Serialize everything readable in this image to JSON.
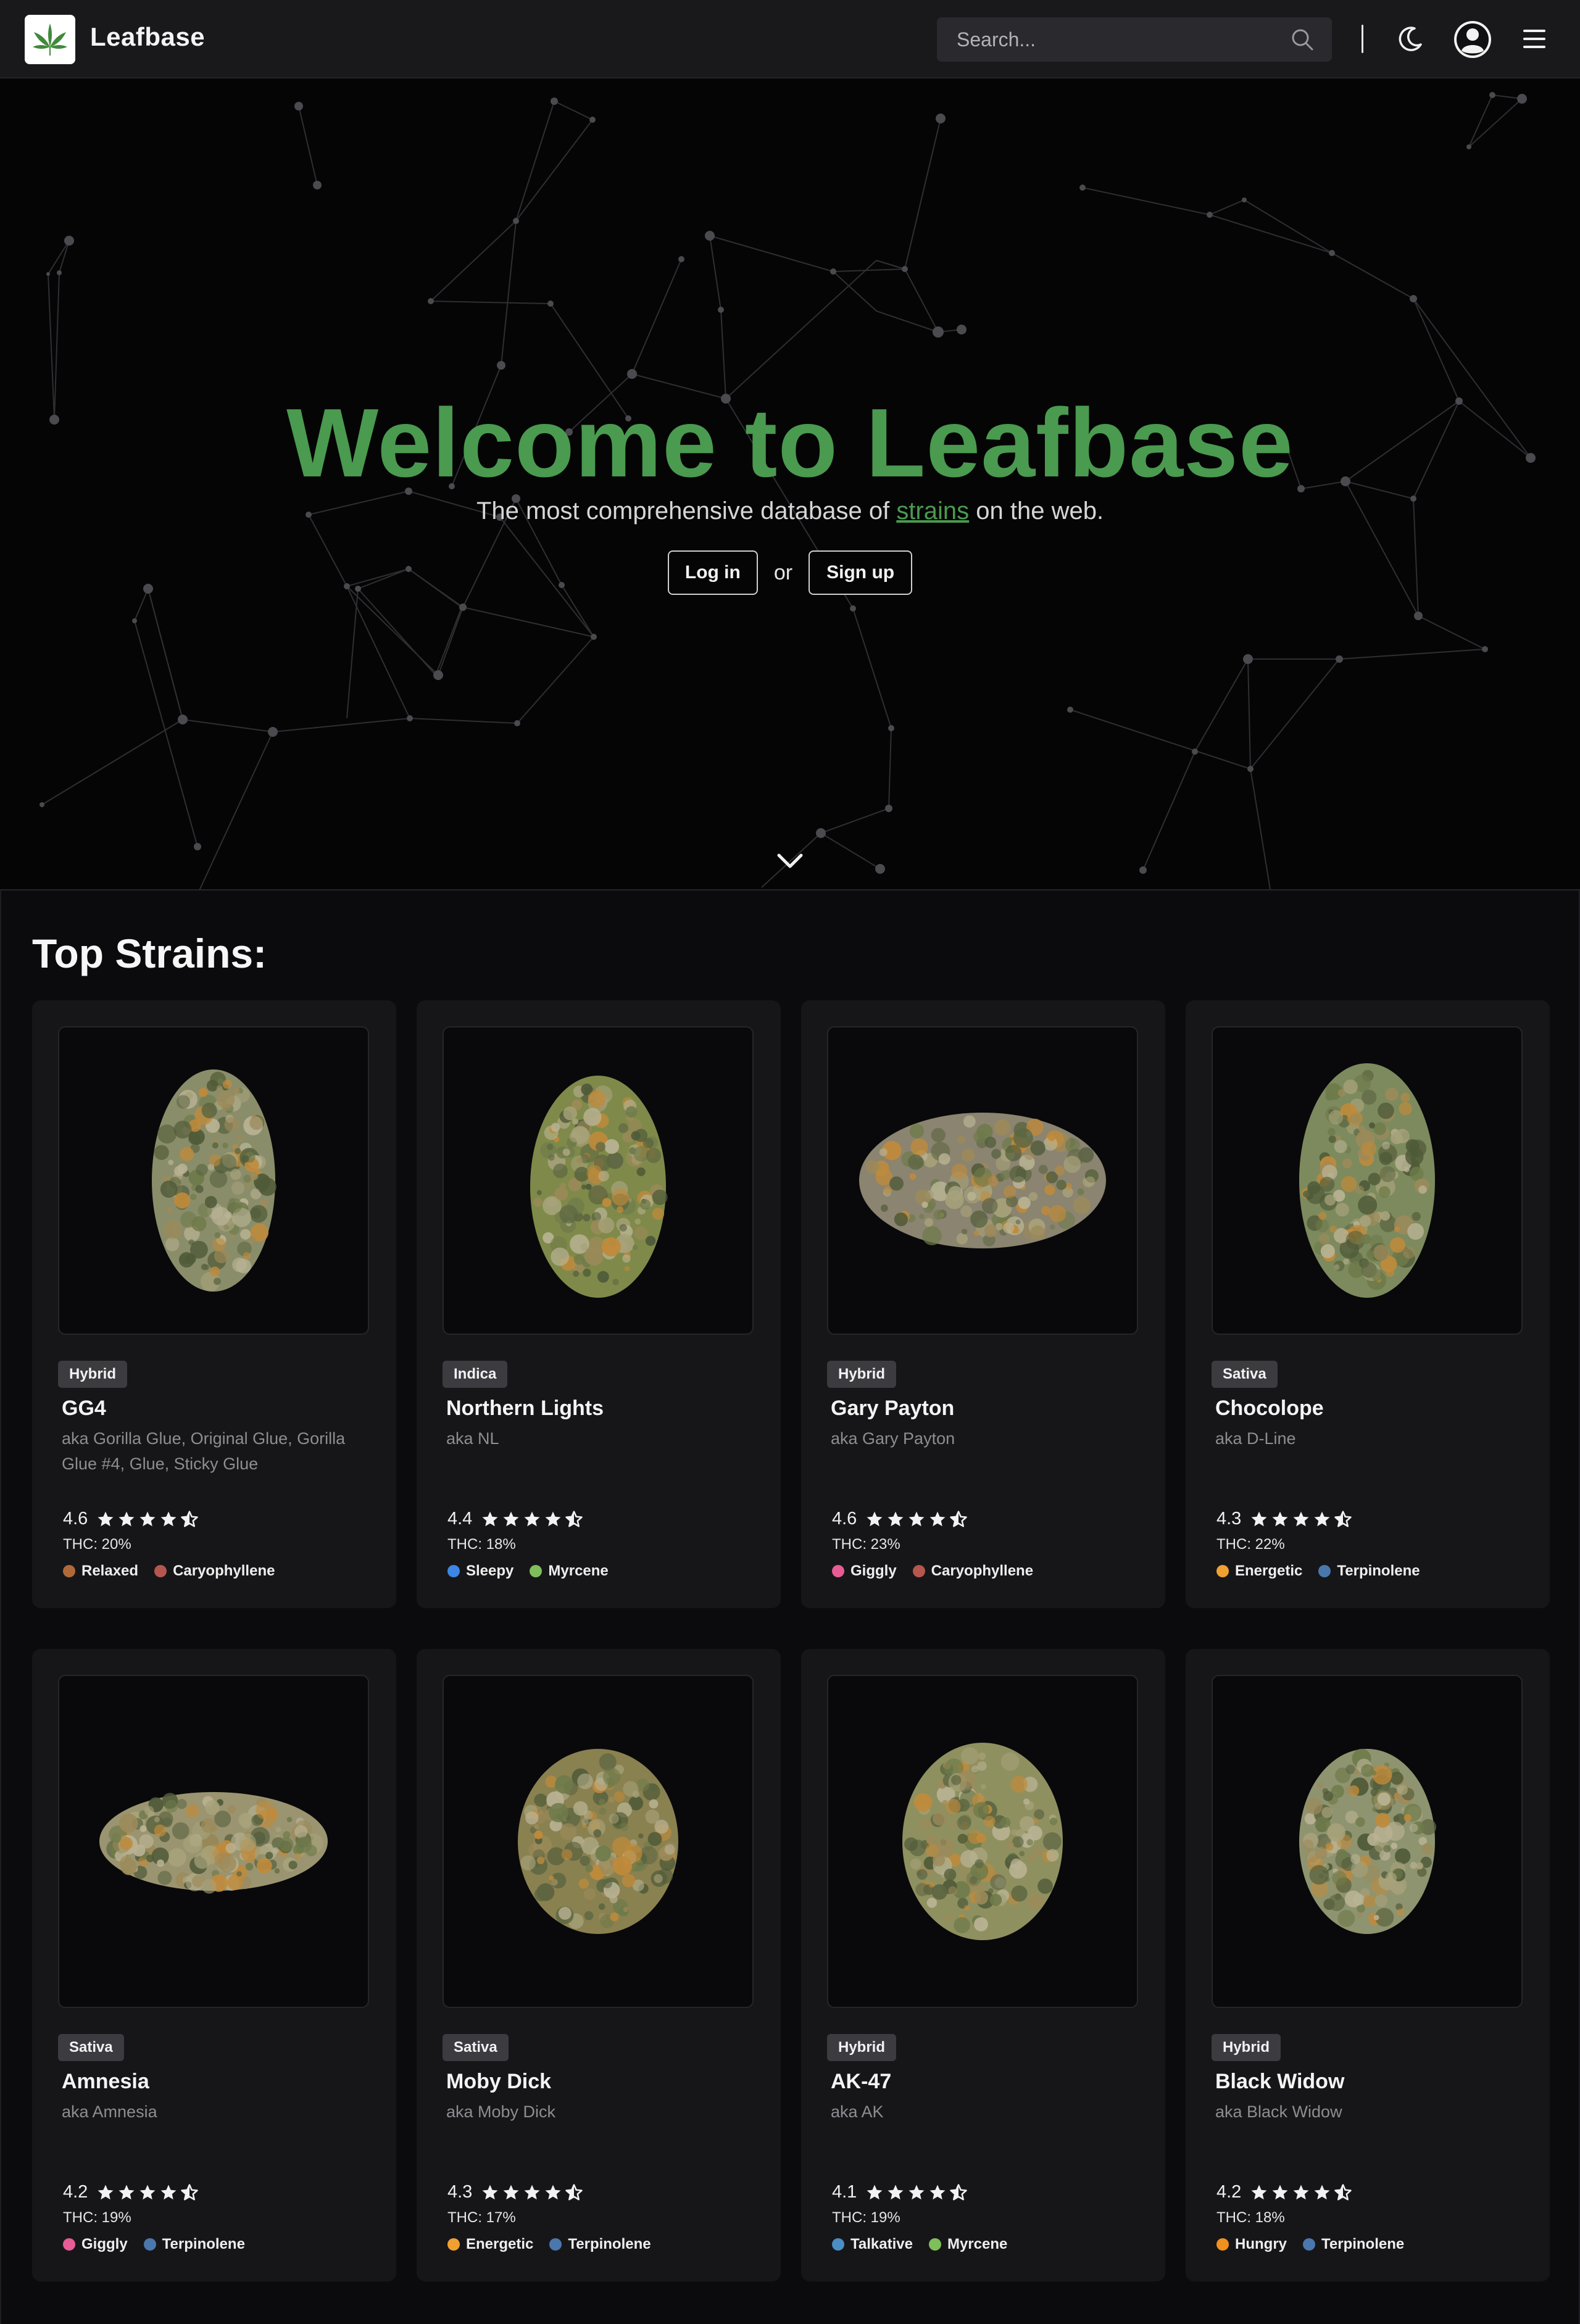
{
  "header": {
    "brand": "Leafbase",
    "search_placeholder": "Search..."
  },
  "hero": {
    "title": "Welcome to Leafbase",
    "subtitle_before": "The most comprehensive database of ",
    "subtitle_link": "strains",
    "subtitle_after": " on the web.",
    "login_label": "Log in",
    "or_label": "or",
    "signup_label": "Sign up"
  },
  "main": {
    "section_title": "Top Strains:"
  },
  "strains": [
    {
      "type": "Hybrid",
      "name": "GG4",
      "aka": "aka Gorilla Glue, Original Glue, Gorilla Glue #4, Glue, Sticky Glue",
      "rating": "4.6",
      "thc": "THC: 20%",
      "tags": [
        {
          "label": "Relaxed",
          "color": "#b06a3a"
        },
        {
          "label": "Caryophyllene",
          "color": "#b5574e"
        }
      ]
    },
    {
      "type": "Indica",
      "name": "Northern Lights",
      "aka": "aka NL",
      "rating": "4.4",
      "thc": "THC: 18%",
      "tags": [
        {
          "label": "Sleepy",
          "color": "#3e86e4"
        },
        {
          "label": "Myrcene",
          "color": "#7fbf5b"
        }
      ]
    },
    {
      "type": "Hybrid",
      "name": "Gary Payton",
      "aka": "aka Gary Payton",
      "rating": "4.6",
      "thc": "THC: 23%",
      "tags": [
        {
          "label": "Giggly",
          "color": "#e85c96"
        },
        {
          "label": "Caryophyllene",
          "color": "#b5574e"
        }
      ]
    },
    {
      "type": "Sativa",
      "name": "Chocolope",
      "aka": "aka D-Line",
      "rating": "4.3",
      "thc": "THC: 22%",
      "tags": [
        {
          "label": "Energetic",
          "color": "#f0a030"
        },
        {
          "label": "Terpinolene",
          "color": "#4a78ad"
        }
      ]
    },
    {
      "type": "Sativa",
      "name": "Amnesia",
      "aka": "aka Amnesia",
      "rating": "4.2",
      "thc": "THC: 19%",
      "tags": [
        {
          "label": "Giggly",
          "color": "#e85c96"
        },
        {
          "label": "Terpinolene",
          "color": "#4a78ad"
        }
      ]
    },
    {
      "type": "Sativa",
      "name": "Moby Dick",
      "aka": "aka Moby Dick",
      "rating": "4.3",
      "thc": "THC: 17%",
      "tags": [
        {
          "label": "Energetic",
          "color": "#f0a030"
        },
        {
          "label": "Terpinolene",
          "color": "#4a78ad"
        }
      ]
    },
    {
      "type": "Hybrid",
      "name": "AK-47",
      "aka": "aka AK",
      "rating": "4.1",
      "thc": "THC: 19%",
      "tags": [
        {
          "label": "Talkative",
          "color": "#4a8ec4"
        },
        {
          "label": "Myrcene",
          "color": "#7fbf5b"
        }
      ]
    },
    {
      "type": "Hybrid",
      "name": "Black Widow",
      "aka": "aka Black Widow",
      "rating": "4.2",
      "thc": "THC: 18%",
      "tags": [
        {
          "label": "Hungry",
          "color": "#f0901e"
        },
        {
          "label": "Terpinolene",
          "color": "#4a78ad"
        }
      ]
    }
  ],
  "colors": {
    "accent": "#4a9a4f",
    "card_bg": "#161619",
    "page_bg": "#0a0a0c"
  }
}
